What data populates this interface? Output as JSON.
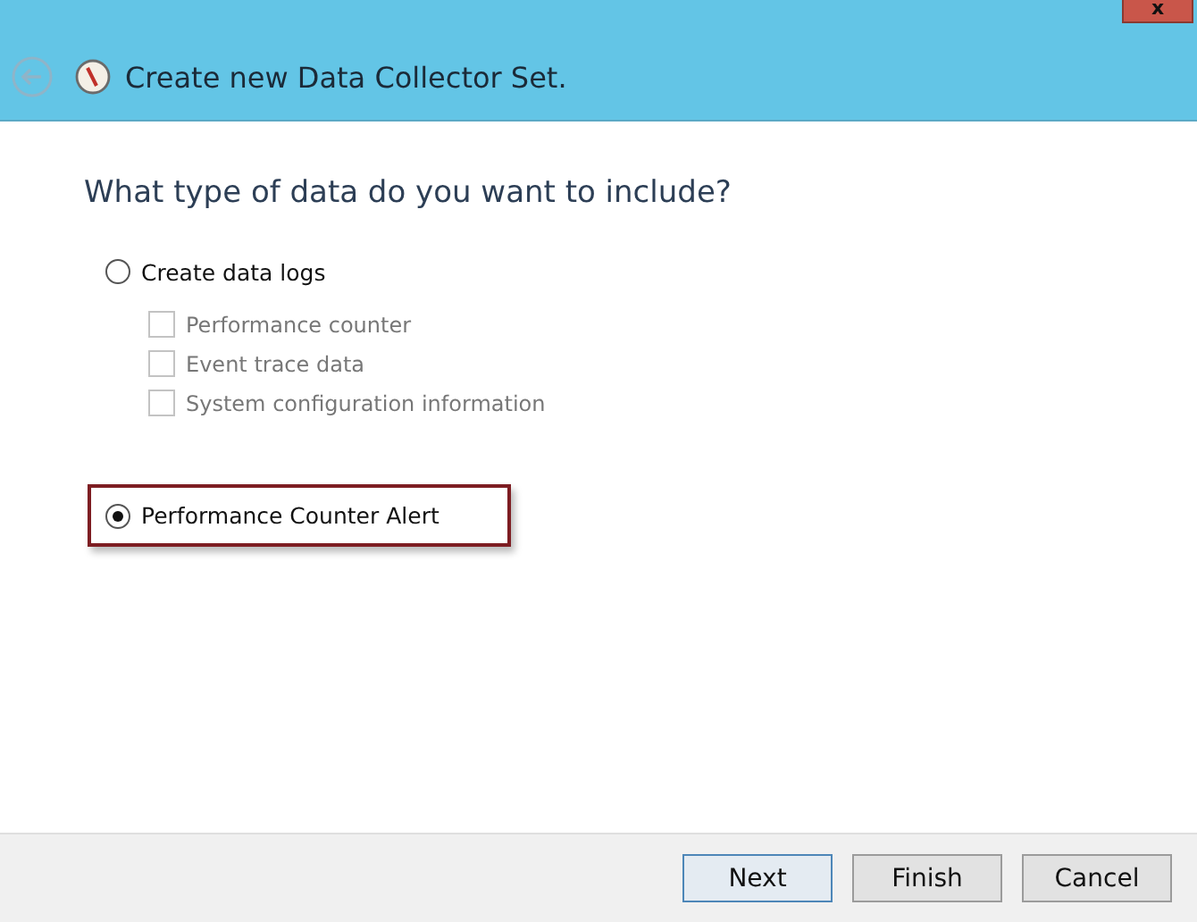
{
  "window": {
    "close": "x",
    "title": "Create new Data Collector Set."
  },
  "heading": "What type of data do you want to include?",
  "options": [
    {
      "label": "Create data logs",
      "selected": false,
      "highlighted": false,
      "children": [
        {
          "label": "Performance counter",
          "checked": false,
          "disabled": true
        },
        {
          "label": "Event trace data",
          "checked": false,
          "disabled": true
        },
        {
          "label": "System configuration information",
          "checked": false,
          "disabled": true
        }
      ]
    },
    {
      "label": "Performance Counter Alert",
      "selected": true,
      "highlighted": true
    }
  ],
  "buttons": [
    {
      "label": "Next",
      "default": true
    },
    {
      "label": "Finish",
      "default": false
    },
    {
      "label": "Cancel",
      "default": false
    }
  ]
}
